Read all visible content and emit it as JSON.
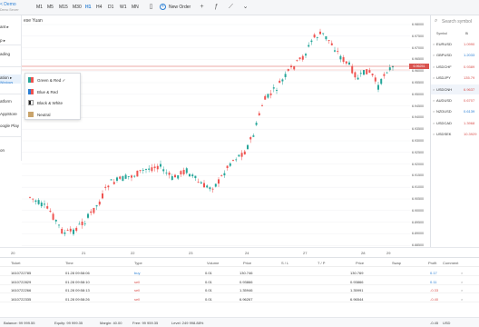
{
  "brand": {
    "name": "< Demo",
    "sub": "Demo Server"
  },
  "toolbar": {
    "timeframes": [
      "M1",
      "M5",
      "M15",
      "M30",
      "H1",
      "H4",
      "D1",
      "W1",
      "MN"
    ],
    "active": "H1",
    "new_order": "New Order",
    "icons": [
      "plus-icon",
      "indicator-icon",
      "objects-icon"
    ]
  },
  "side_menu": {
    "items": [
      {
        "label": "ant",
        "arrow": true
      },
      {
        "label": "p",
        "arrow": true
      },
      {
        "label": "ading",
        "arrow": false
      },
      {
        "label": "ation",
        "arrow": true
      },
      {
        "label": "Windows",
        "arrow": false
      },
      {
        "label": "atform",
        "arrow": false
      },
      {
        "label": "AppStore",
        "arrow": false
      },
      {
        "label": "oogle Play",
        "arrow": false
      },
      {
        "label": "on",
        "arrow": false
      }
    ]
  },
  "chart": {
    "title": "ese Yuan"
  },
  "submenu": {
    "items": [
      {
        "label": "Green & Red",
        "colors": [
          "#26a69a",
          "#ef5350"
        ],
        "selected": true
      },
      {
        "label": "Blue & Red",
        "colors": [
          "#2a7fd4",
          "#ef5350"
        ],
        "selected": false
      },
      {
        "label": "Black & White",
        "colors": [
          "#222222",
          "#ffffff"
        ],
        "selected": false
      },
      {
        "label": "Neutral",
        "colors": [
          "#c9a46c",
          "#c9a46c"
        ],
        "selected": false
      }
    ]
  },
  "price_axis": {
    "labels": [
      "6.98000",
      "6.97500",
      "6.97000",
      "6.96500",
      "6.96000",
      "6.95500",
      "6.95000",
      "6.94500",
      "6.94000",
      "6.93500",
      "6.93000",
      "6.92500",
      "6.92000",
      "6.91500",
      "6.91000",
      "6.90500",
      "6.90000",
      "6.89500",
      "6.89000",
      "6.88500"
    ],
    "current": "6.96251"
  },
  "date_axis": {
    "labels": [
      "20",
      "21",
      "22",
      "23",
      "24",
      "27",
      "28",
      "29"
    ]
  },
  "watchlist": {
    "search_placeholder": "Search symbol",
    "col_symbol": "Symbol",
    "col_bid": "Bi",
    "rows": [
      {
        "symbol": "EURUSD",
        "bid": "1.0990",
        "color": "#d9534f"
      },
      {
        "symbol": "GBPUSD",
        "bid": "1.2033",
        "color": "#2a7fd4"
      },
      {
        "symbol": "USDCHF",
        "bid": "0.9389",
        "color": "#d9534f"
      },
      {
        "symbol": "USDJPY",
        "bid": "135.79",
        "color": "#d9534f"
      },
      {
        "symbol": "USDCNH",
        "bid": "6.9637",
        "color": "#d9534f"
      },
      {
        "symbol": "AUDUSD",
        "bid": "0.6707",
        "color": "#d9534f"
      },
      {
        "symbol": "NZDUSD",
        "bid": "0.6139",
        "color": "#2a7fd4"
      },
      {
        "symbol": "USDCAD",
        "bid": "1.3968",
        "color": "#d9534f"
      },
      {
        "symbol": "USDSEK",
        "bid": "10.3929",
        "color": "#d9534f"
      }
    ]
  },
  "trades": {
    "headers": [
      "Ticket",
      "Time",
      "Type",
      "Volume",
      "Price",
      "S / L",
      "T / P",
      "Price",
      "Swap",
      "Profit",
      "Comment"
    ],
    "rows": [
      {
        "ticket": "1610722785",
        "time": "01.28 09:58:06",
        "type": "buy",
        "volume": "0.01",
        "price": "130.746",
        "price2": "130.769",
        "profit": "0.17"
      },
      {
        "ticket": "1610722829",
        "time": "01.28 09:58:10",
        "type": "sell",
        "volume": "0.01",
        "price": "0.93866",
        "price2": "0.93866",
        "profit": "0.11"
      },
      {
        "ticket": "1610722266",
        "time": "01.28 09:58:13",
        "type": "sell",
        "volume": "0.01",
        "price": "1.35946",
        "price2": "1.35991",
        "profit": "-0.33"
      },
      {
        "ticket": "1610722335",
        "time": "01.28 09:58:26",
        "type": "sell",
        "volume": "0.01",
        "price": "6.96267",
        "price2": "6.96544",
        "profit": "-0.40"
      }
    ]
  },
  "footer": {
    "balance": "Balance: 99 999.55",
    "equity": "Equity: 99 999.35",
    "margin": "Margin: 40.00",
    "free": "Free: 99 959.35",
    "level": "Level: 249 998.88%",
    "total": "-0.45",
    "total_profit": "USD"
  }
}
